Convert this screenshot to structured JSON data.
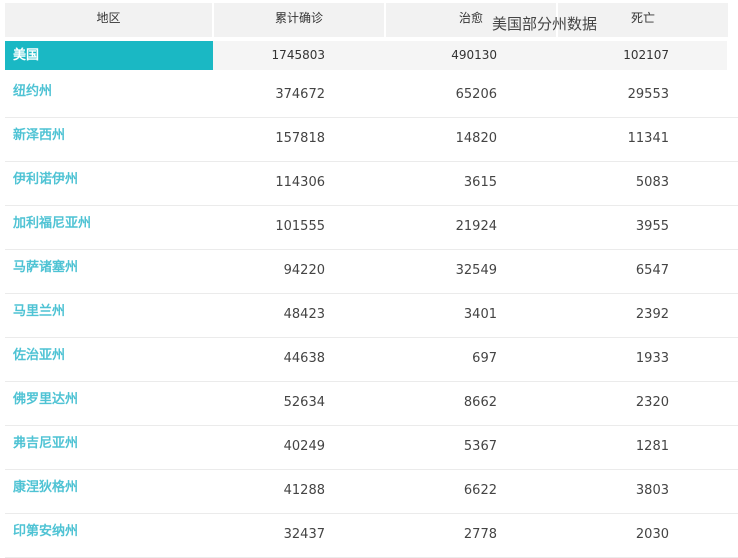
{
  "chart_title": "美国部分州数据",
  "headers": [
    "地区",
    "累计确诊",
    "治愈",
    "死亡"
  ],
  "total": {
    "region": "美国",
    "confirmed": "1745803",
    "recovered": "490130",
    "deaths": "102107"
  },
  "rows": [
    {
      "region": "纽约州",
      "confirmed": "374672",
      "recovered": "65206",
      "deaths": "29553"
    },
    {
      "region": "新泽西州",
      "confirmed": "157818",
      "recovered": "14820",
      "deaths": "11341"
    },
    {
      "region": "伊利诺伊州",
      "confirmed": "114306",
      "recovered": "3615",
      "deaths": "5083"
    },
    {
      "region": "加利福尼亚州",
      "confirmed": "101555",
      "recovered": "21924",
      "deaths": "3955"
    },
    {
      "region": "马萨诸塞州",
      "confirmed": "94220",
      "recovered": "32549",
      "deaths": "6547"
    },
    {
      "region": "马里兰州",
      "confirmed": "48423",
      "recovered": "3401",
      "deaths": "2392"
    },
    {
      "region": "佐治亚州",
      "confirmed": "44638",
      "recovered": "697",
      "deaths": "1933"
    },
    {
      "region": "佛罗里达州",
      "confirmed": "52634",
      "recovered": "8662",
      "deaths": "2320"
    },
    {
      "region": "弗吉尼亚州",
      "confirmed": "40249",
      "recovered": "5367",
      "deaths": "1281"
    },
    {
      "region": "康涅狄格州",
      "confirmed": "41288",
      "recovered": "6622",
      "deaths": "3803"
    },
    {
      "region": "印第安纳州",
      "confirmed": "32437",
      "recovered": "2778",
      "deaths": "2030"
    }
  ],
  "colors": {
    "accent": "#1ab8c4",
    "link": "#4fc3d4",
    "header_bg": "#f2f2f2"
  }
}
